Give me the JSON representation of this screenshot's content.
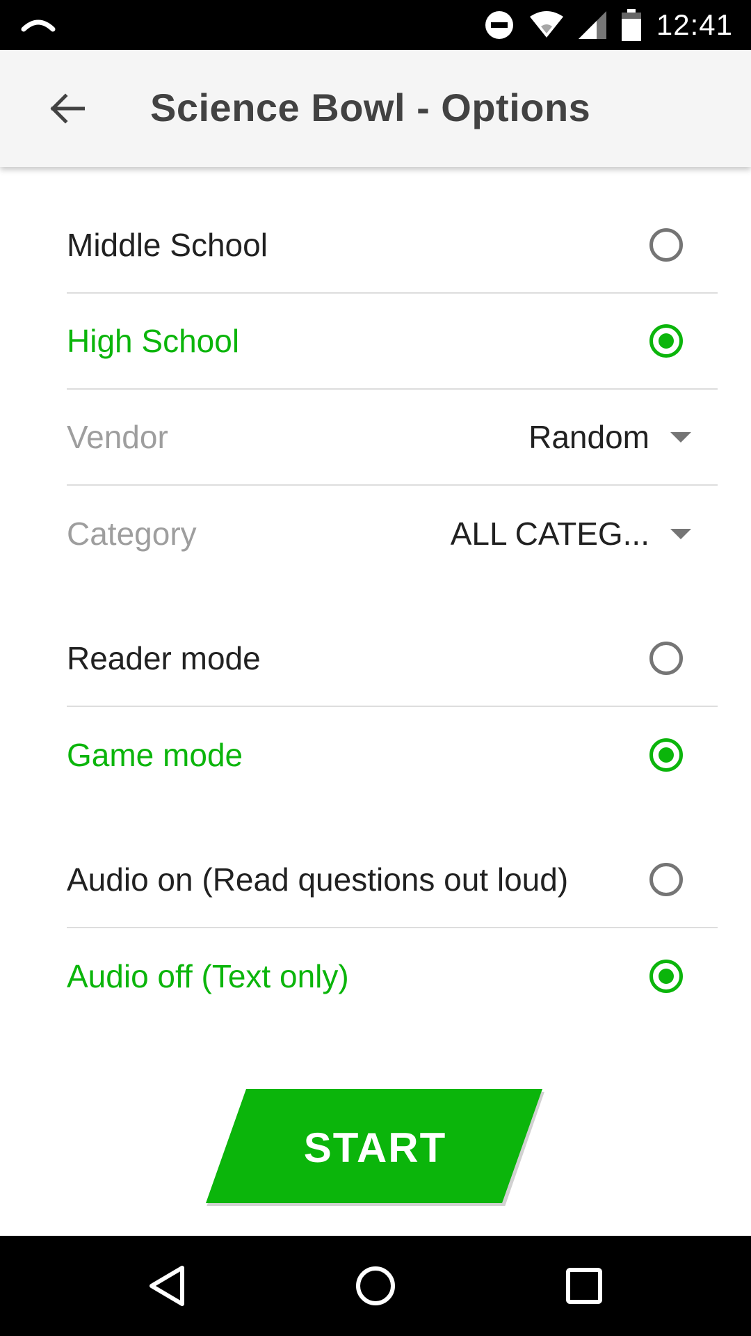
{
  "status_bar": {
    "time": "12:41",
    "icons": [
      "arc-notification-icon",
      "do-not-disturb-icon",
      "wifi-icon",
      "cell-signal-icon",
      "battery-icon"
    ]
  },
  "app_bar": {
    "title": "Science Bowl - Options",
    "back_icon": "arrow-back-icon"
  },
  "level": {
    "options": [
      {
        "label": "Middle School",
        "checked": false
      },
      {
        "label": "High School",
        "checked": true
      }
    ]
  },
  "vendor": {
    "label": "Vendor",
    "value": "Random"
  },
  "category": {
    "label": "Category",
    "value": "ALL CATEG..."
  },
  "mode": {
    "options": [
      {
        "label": "Reader mode",
        "checked": false
      },
      {
        "label": "Game mode",
        "checked": true
      }
    ]
  },
  "audio": {
    "options": [
      {
        "label": "Audio on (Read questions out loud)",
        "checked": false
      },
      {
        "label": "Audio off (Text only)",
        "checked": true
      }
    ]
  },
  "start_button": {
    "label": "START"
  },
  "colors": {
    "accent": "#0bb50b",
    "text": "#212121",
    "muted": "#9e9e9e",
    "app_bar": "#f5f5f5"
  },
  "nav_bar": {
    "icons": [
      "back-triangle-icon",
      "home-circle-icon",
      "recents-square-icon"
    ]
  }
}
